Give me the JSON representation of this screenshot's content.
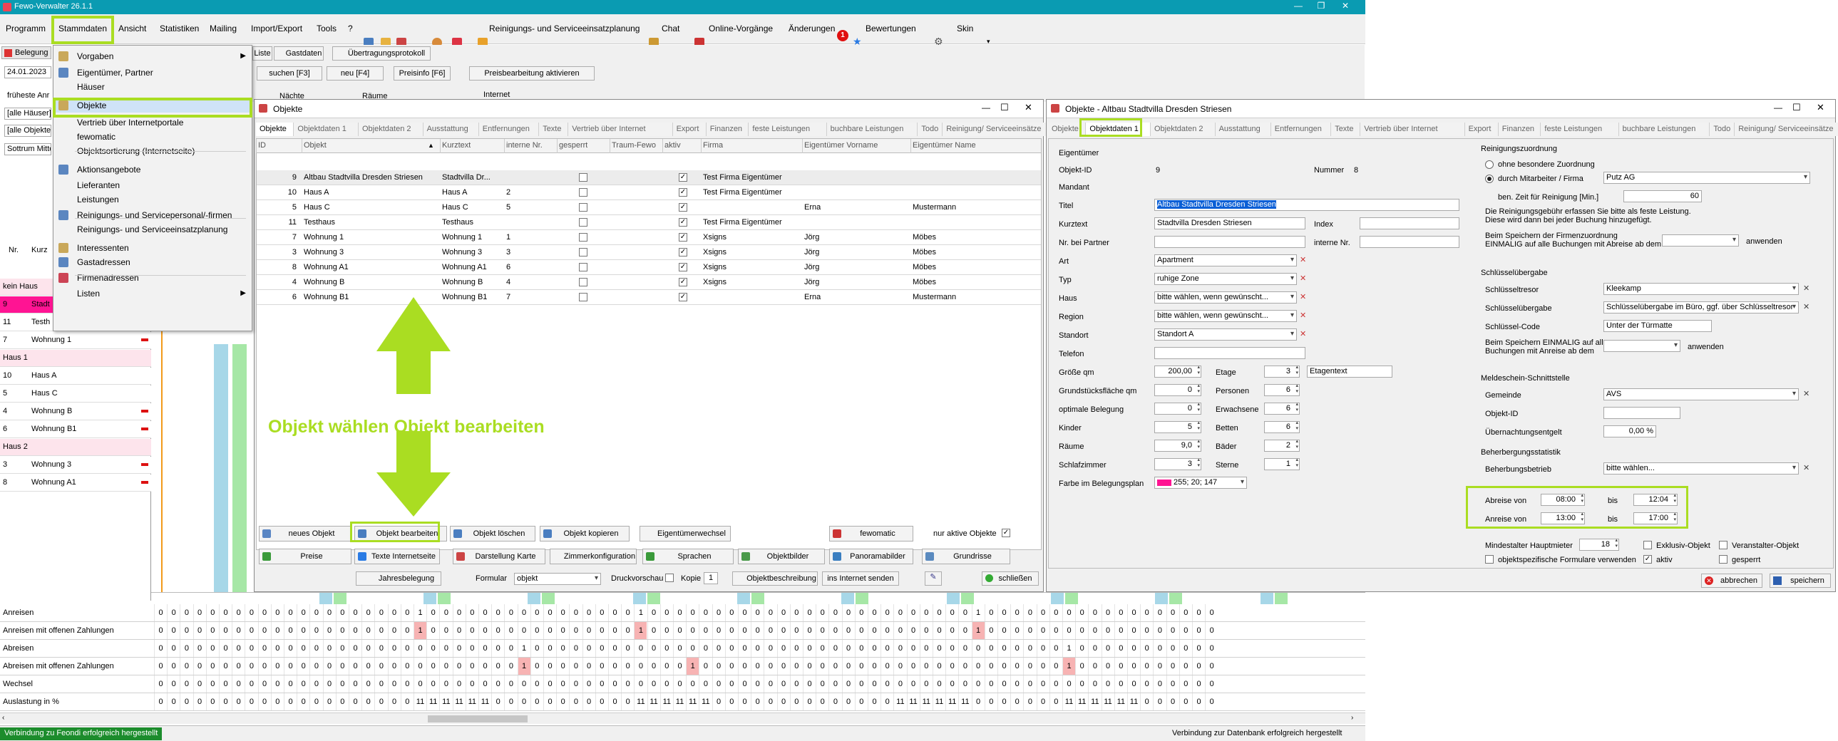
{
  "app": {
    "title": "Fewo-Verwalter 26.1.1"
  },
  "menubar": {
    "items": [
      "Programm",
      "Stammdaten",
      "Ansicht",
      "Statistiken",
      "Mailing",
      "Import/Export",
      "Tools",
      "?"
    ],
    "toolbar_items": [
      "Reinigungs- und Serviceeinsatzplanung",
      "Chat",
      "Online-Vorgänge",
      "Änderungen",
      "Bewertungen",
      "Skin"
    ],
    "notification_count": "1"
  },
  "stammdaten_menu": {
    "items": [
      {
        "label": "Vorgaben",
        "arrow": true
      },
      {
        "label": "Eigentümer, Partner"
      },
      {
        "label": "Häuser"
      },
      {
        "label": "Objekte",
        "selected": true
      },
      {
        "label": "Vertrieb über Internetportale"
      },
      {
        "label": "fewomatic"
      },
      {
        "label": "Objektsortierung (Internetseite)"
      },
      {
        "label": "Aktionsangebote"
      },
      {
        "label": "Lieferanten"
      },
      {
        "label": "Leistungen"
      },
      {
        "label": "Reinigungs- und Servicepersonal/-firmen"
      },
      {
        "label": "Reinigungs- und Serviceeinsatzplanung"
      },
      {
        "label": "Interessenten"
      },
      {
        "label": "Gastadressen"
      },
      {
        "label": "Firmenadressen"
      },
      {
        "label": "Listen",
        "arrow": true
      }
    ]
  },
  "left_panel": {
    "belegung_tab": "Belegung",
    "date": "24.01.2023",
    "frueheste": "früheste Anr",
    "filters": [
      "[alle Häuser]",
      "[alle Objekte]",
      "Sottrum Mitte"
    ],
    "col_nr": "Nr.",
    "col_kurz": "Kurz",
    "rows": [
      {
        "nr": "",
        "name": "kein Haus",
        "type": "group"
      },
      {
        "nr": "9",
        "name": "Stadt",
        "type": "pink"
      },
      {
        "nr": "11",
        "name": "Testh",
        "type": "plain"
      },
      {
        "nr": "7",
        "name": "Wohnung 1",
        "type": "plain"
      },
      {
        "nr": "",
        "name": "Haus 1",
        "type": "group"
      },
      {
        "nr": "10",
        "name": "Haus A",
        "type": "plain"
      },
      {
        "nr": "5",
        "name": "Haus C",
        "type": "plain"
      },
      {
        "nr": "4",
        "name": "Wohnung B",
        "type": "plain"
      },
      {
        "nr": "6",
        "name": "Wohnung B1",
        "type": "plain"
      },
      {
        "nr": "",
        "name": "Haus 2",
        "type": "group"
      },
      {
        "nr": "3",
        "name": "Wohnung 3",
        "type": "plain"
      },
      {
        "nr": "8",
        "name": "Wohnung A1",
        "type": "plain"
      }
    ]
  },
  "top_toolbar": {
    "tabs": [
      "Liste",
      "Gastdaten",
      "Übertragungsprotokoll"
    ],
    "buttons": [
      "suchen [F3]",
      "neu [F4]",
      "Preisinfo [F6]",
      "Preisbearbeitung aktivieren"
    ],
    "naechte": "Nächte",
    "raeume": "Räume",
    "internet": "Internet"
  },
  "objekte_window": {
    "title": "Objekte",
    "tabs": [
      "Objekte",
      "Objektdaten 1",
      "Objektdaten 2",
      "Ausstattung",
      "Entfernungen",
      "Texte",
      "Vertrieb über Internet",
      "Export",
      "Finanzen",
      "feste Leistungen",
      "buchbare Leistungen",
      "Todo",
      "Reinigung/ Serviceeinsätze"
    ],
    "columns": [
      "ID",
      "Objekt",
      "Kurztext",
      "interne Nr.",
      "gesperrt",
      "Traum-Fewo",
      "aktiv",
      "Firma",
      "Eigentümer Vorname",
      "Eigentümer Name"
    ],
    "rows": [
      {
        "id": "9",
        "objekt": "Altbau Stadtvilla Dresden Striesen",
        "kurz": "Stadtvilla Dr...",
        "nr": "",
        "aktiv": true,
        "firma": "Test Firma Eigentümer",
        "vorname": "",
        "name": ""
      },
      {
        "id": "10",
        "objekt": "Haus A",
        "kurz": "Haus A",
        "nr": "2",
        "aktiv": true,
        "firma": "Test Firma Eigentümer",
        "vorname": "",
        "name": ""
      },
      {
        "id": "5",
        "objekt": "Haus C",
        "kurz": "Haus C",
        "nr": "5",
        "aktiv": true,
        "firma": "",
        "vorname": "Erna",
        "name": "Mustermann"
      },
      {
        "id": "11",
        "objekt": "Testhaus",
        "kurz": "Testhaus",
        "nr": "",
        "aktiv": true,
        "firma": "Test Firma Eigentümer",
        "vorname": "",
        "name": ""
      },
      {
        "id": "7",
        "objekt": "Wohnung 1",
        "kurz": "Wohnung 1",
        "nr": "1",
        "aktiv": true,
        "firma": "Xsigns",
        "vorname": "Jörg",
        "name": "Möbes"
      },
      {
        "id": "3",
        "objekt": "Wohnung 3",
        "kurz": "Wohnung 3",
        "nr": "3",
        "aktiv": true,
        "firma": "Xsigns",
        "vorname": "Jörg",
        "name": "Möbes"
      },
      {
        "id": "8",
        "objekt": "Wohnung A1",
        "kurz": "Wohnung A1",
        "nr": "6",
        "aktiv": true,
        "firma": "Xsigns",
        "vorname": "Jörg",
        "name": "Möbes"
      },
      {
        "id": "4",
        "objekt": "Wohnung B",
        "kurz": "Wohnung B",
        "nr": "4",
        "aktiv": true,
        "firma": "Xsigns",
        "vorname": "Jörg",
        "name": "Möbes"
      },
      {
        "id": "6",
        "objekt": "Wohnung B1",
        "kurz": "Wohnung B1",
        "nr": "7",
        "aktiv": true,
        "firma": "",
        "vorname": "Erna",
        "name": "Mustermann"
      }
    ],
    "annotation": "Objekt wählen Objekt bearbeiten",
    "buttons_row1": [
      "neues Objekt",
      "Objekt bearbeiten",
      "Objekt löschen",
      "Objekt kopieren",
      "Eigentümerwechsel",
      "fewomatic"
    ],
    "nur_aktive": "nur aktive Objekte",
    "buttons_row2": [
      "Preise",
      "Texte Internetseite",
      "Darstellung Karte",
      "Zimmerkonfiguration",
      "Sprachen",
      "Objektbilder",
      "Panoramabilder",
      "Grundrisse"
    ],
    "jahresbelegung": "Jahresbelegung",
    "formular_label": "Formular",
    "formular_value": "objekt",
    "druckvorschau": "Druckvorschau",
    "kopie": "Kopie",
    "kopie_value": "1",
    "objektbeschreibung": "Objektbeschreibung",
    "ins_internet": "ins Internet senden",
    "schliessen": "schließen"
  },
  "detail_window": {
    "title": "Objekte - Altbau Stadtvilla Dresden Striesen",
    "tabs": [
      "Objekte",
      "Objektdaten 1",
      "Objektdaten 2",
      "Ausstattung",
      "Entfernungen",
      "Texte",
      "Vertrieb über Internet",
      "Export",
      "Finanzen",
      "feste Leistungen",
      "buchbare Leistungen",
      "Todo",
      "Reinigung/ Serviceeinsätze"
    ],
    "eigentuemer": "Eigentümer",
    "objekt_id_label": "Objekt-ID",
    "objekt_id": "9",
    "nummer_label": "Nummer",
    "nummer": "8",
    "mandant": "Mandant",
    "titel_label": "Titel",
    "titel": "Altbau Stadtvilla Dresden Striesen",
    "kurztext_label": "Kurztext",
    "kurztext": "Stadtvilla Dresden Striesen",
    "index_label": "Index",
    "partner_label": "Nr. bei Partner",
    "interne_label": "interne Nr.",
    "art_label": "Art",
    "art": "Apartment",
    "typ_label": "Typ",
    "typ": "ruhige Zone",
    "haus_label": "Haus",
    "haus": "bitte wählen, wenn gewünscht...",
    "region_label": "Region",
    "region": "bitte wählen, wenn gewünscht...",
    "standort_label": "Standort",
    "standort": "Standort A",
    "telefon_label": "Telefon",
    "groesse_label": "Größe qm",
    "groesse": "200,00",
    "etage_label": "Etage",
    "etage": "3",
    "etagentext": "Etagentext",
    "grund_label": "Grundstücksfläche  qm",
    "grund": "0",
    "personen_label": "Personen",
    "personen": "6",
    "optimal_label": "optimale Belegung",
    "optimal": "0",
    "erwachsene_label": "Erwachsene",
    "erwachsene": "6",
    "kinder_label": "Kinder",
    "kinder": "5",
    "betten_label": "Betten",
    "betten": "6",
    "raeume_label": "Räume",
    "raeume": "9,0",
    "baeder_label": "Bäder",
    "baeder": "2",
    "schlaf_label": "Schlafzimmer",
    "schlaf": "3",
    "sterne_label": "Sterne",
    "sterne": "1",
    "farbe_label": "Farbe im Belegungsplan",
    "farbe": "255; 20; 147",
    "farbe_color": "#ff1493",
    "reinigung_title": "Reinigungszuordnung",
    "ohne": "ohne besondere Zuordnung",
    "durch": "durch Mitarbeiter / Firma",
    "firma": "Putz AG",
    "zeit_label": "ben. Zeit für Reinigung [Min.]",
    "zeit": "60",
    "reinigung_hint1": "Die Reinigungsgebühr erfassen Sie bitte als feste Leistung.",
    "reinigung_hint2": "Diese wird dann bei jeder Buchung hinzugefügt.",
    "speichern_firma1": "Beim Speichern der Firmenzuordnung",
    "speichern_firma2": "EINMALIG auf alle Buchungen mit Abreise ab dem",
    "anwenden": "anwenden",
    "schluessel_title": "Schlüsselübergabe",
    "tresor_label": "Schlüsseltresor",
    "tresor": "Kleekamp",
    "uebergabe_label": "Schlüsselübergabe",
    "uebergabe": "Schlüsselübergabe im Büro, ggf. über Schlüsseltresor",
    "code_label": "Schlüssel-Code",
    "code": "Unter der Türmatte",
    "speichern_s1": "Beim Speichern EINMALIG auf alle",
    "speichern_s2": "Buchungen mit Anreise ab dem",
    "melde_title": "Meldeschein-Schnittstelle",
    "gemeinde_label": "Gemeinde",
    "gemeinde": "AVS",
    "objektid2_label": "Objekt-ID",
    "uebernacht_label": "Übernachtungsentgelt",
    "uebernacht": "0,00 %",
    "beherb_title": "Beherbergungsstatistik",
    "betrieb_label": "Beherbungsbetrieb",
    "betrieb": "bitte wählen...",
    "abreise_label": "Abreise von",
    "abreise_von": "08:00",
    "bis": "bis",
    "abreise_bis": "12:04",
    "anreise_label": "Anreise von",
    "anreise_von": "13:00",
    "anreise_bis": "17:00",
    "mindest_label": "Mindestalter Hauptmieter",
    "mindest": "18",
    "exklusiv": "Exklusiv-Objekt",
    "veranstalter": "Veranstalter-Objekt",
    "formulare": "objektspezifische Formulare verwenden",
    "aktiv": "aktiv",
    "gesperrt": "gesperrt",
    "abbrechen": "abbrechen",
    "speichern": "speichern"
  },
  "stats": {
    "rows": [
      {
        "label": "Anreisen",
        "values": "0 0 0 0 0 0 0 0 0 0 0 0 0 0 0 0 0 0 0 0 1 0 0 0 0 0 0 0 0 0 0 0 0 0 0 0 0 1 0 0 0 0 0 0 0 0 0 0 0 0 0 0 0 0 0 0 0 0 0 0 0 0 0 1 0 0 0 0 0 0 0 0 0 0 0 0 0 0 0 0 0 0"
      },
      {
        "label": "Anreisen mit offenen Zahlungen",
        "values": "0 0 0 0 0 0 0 0 0 0 0 0 0 0 0 0 0 0 0 0 1 0 0 0 0 0 0 0 0 0 0 0 0 0 0 0 0 1 0 0 0 0 0 0 0 0 0 0 0 0 0 0 0 0 0 0 0 0 0 0 0 0 0 1 0 0 0 0 0 0 0 0 0 0 0 0 0 0 0 0 0 0"
      },
      {
        "label": "Abreisen",
        "values": "0 0 0 0 0 0 0 0 0 0 0 0 0 0 0 0 0 0 0 0 0 0 0 0 0 0 0 0 1 0 0 0 0 0 0 0 0 0 0 0 0 0 0 0 0 0 0 0 0 0 0 0 0 0 0 0 0 0 0 0 0 0 0 0 0 0 0 0 0 0 1 0 0 0 0 0 0 0 0 0 0 0"
      },
      {
        "label": "Abreisen mit offenen Zahlungen",
        "values": "0 0 0 0 0 0 0 0 0 0 0 0 0 0 0 0 0 0 0 0 0 0 0 0 0 0 0 0 1 0 0 0 0 0 0 0 0 0 0 0 0 1 0 0 0 0 0 0 0 0 0 0 0 0 0 0 0 0 0 0 0 0 0 0 0 0 0 0 0 0 1 0 0 0 0 0 0 0 0 0 0 0"
      },
      {
        "label": "Wechsel",
        "values": "0 0 0 0 0 0 0 0 0 0 0 0 0 0 0 0 0 0 0 0 0 0 0 0 0 0 0 0 0 0 0 0 0 0 0 0 0 0 0 0 0 0 0 0 0 0 0 0 0 0 0 0 0 0 0 0 0 0 0 0 0 0 0 0 0 0 0 0 0 0 0 0 0 0 0 0 0 0 0 0 0 0"
      },
      {
        "label": "Auslastung in %",
        "values": "0 0 0 0 0 0 0 0 0 0 0 0 0 0 0 0 0 0 0 0 11 11 11 11 11 11 0 0 0 0 0 0 0 0 0 0 0 11 11 11 11 11 11 0 0 0 0 0 0 0 0 0 0 0 0 0 0 11 11 11 11 11 11 0 0 0 0 0 0 0 11 11 11 11 11 11 0 0 0 0 0 0"
      }
    ]
  },
  "statusbar": {
    "left": "Verbindung zu Feondi erfolgreich hergestellt",
    "right": "Verbindung zur Datenbank erfolgreich hergestellt"
  },
  "colors": {
    "accent_green": "#aadd22",
    "title_teal": "#0a9bb2",
    "status_green": "#1c8c2c"
  }
}
